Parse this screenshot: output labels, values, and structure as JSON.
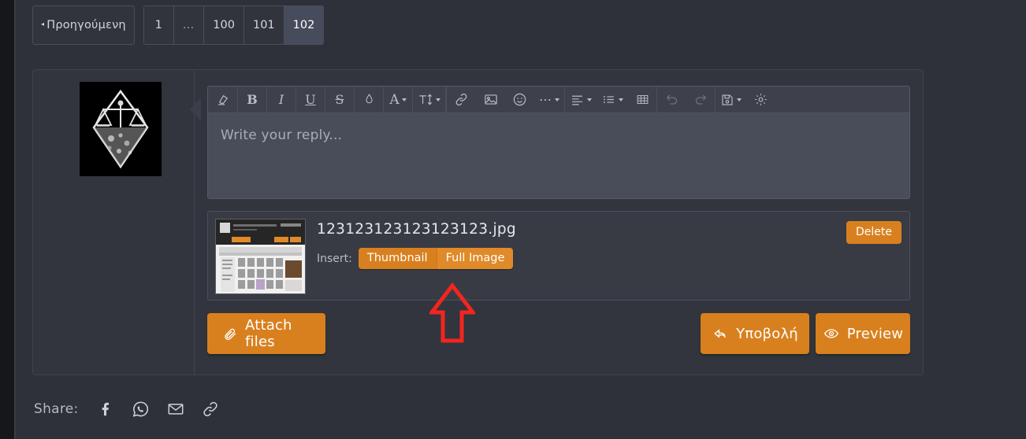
{
  "pagination": {
    "previous_label": "Προηγούμενη",
    "prev_caret": "◂",
    "pages": [
      "1",
      "…",
      "100",
      "101",
      "102"
    ],
    "active_page": "102"
  },
  "post": {
    "avatar_name": "user-avatar-logo"
  },
  "editor": {
    "placeholder": "Write your reply...",
    "toolbar": [
      {
        "name": "clear-formatting-icon",
        "tooltip": "Remove formatting"
      },
      {
        "name": "bold-icon",
        "label": "B"
      },
      {
        "name": "italic-icon",
        "label": "I"
      },
      {
        "name": "underline-icon",
        "label": "U"
      },
      {
        "name": "strikethrough-icon",
        "label": "S"
      },
      {
        "name": "text-color-icon",
        "label": ""
      },
      {
        "name": "font-family-icon",
        "label": "A"
      },
      {
        "name": "font-size-icon",
        "label": "T"
      },
      {
        "name": "link-icon",
        "label": ""
      },
      {
        "name": "image-icon",
        "label": ""
      },
      {
        "name": "emoji-icon",
        "label": ""
      },
      {
        "name": "more-options-icon",
        "label": "…"
      },
      {
        "name": "align-icon",
        "label": ""
      },
      {
        "name": "list-icon",
        "label": ""
      },
      {
        "name": "table-icon",
        "label": ""
      },
      {
        "name": "undo-icon",
        "label": ""
      },
      {
        "name": "redo-icon",
        "label": ""
      },
      {
        "name": "draft-icon",
        "label": ""
      },
      {
        "name": "settings-gear-icon",
        "label": ""
      }
    ]
  },
  "attachment": {
    "filename": "123123123123123123.jpg",
    "insert_label": "Insert:",
    "thumbnail_label": "Thumbnail",
    "full_image_label": "Full Image",
    "delete_label": "Delete"
  },
  "actions": {
    "attach_files_label": "Attach files",
    "submit_label": "Υποβολή",
    "preview_label": "Preview"
  },
  "share": {
    "label": "Share:",
    "targets": [
      "facebook-icon",
      "whatsapp-icon",
      "email-icon",
      "link-icon"
    ]
  },
  "annotation": {
    "type": "red-up-arrow",
    "points_at": "Full Image",
    "color": "#f2251f"
  },
  "colors": {
    "page_background": "#2e3139",
    "panel_background": "#32353d",
    "toolbar_background": "#3e414b",
    "editor_background": "#494d59",
    "accent_orange": "#d9801e",
    "accent_orange_hover": "#e08a29",
    "active_page_background": "#464c5c",
    "annotation_red": "#f2251f"
  }
}
